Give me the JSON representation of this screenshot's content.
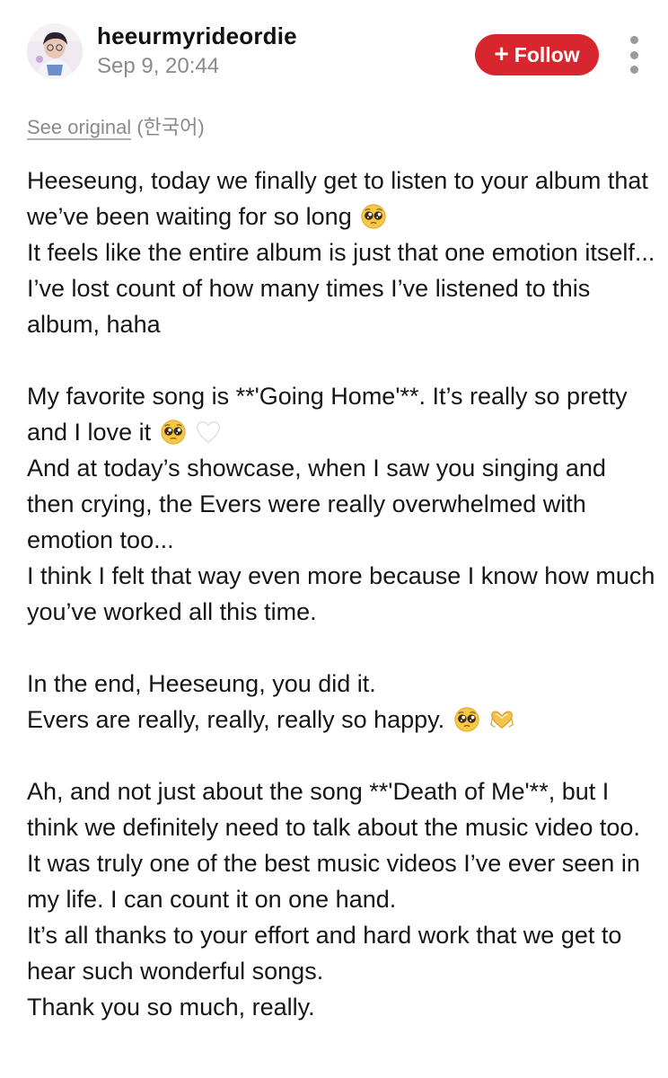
{
  "post": {
    "author": {
      "username": "heeurmyrideordie",
      "avatar": "profile-avatar"
    },
    "timestamp": "Sep 9, 20:44",
    "follow_label": "Follow",
    "follow_icon": "+",
    "more_icon": "more-vertical-icon",
    "accent_color": "#d8262e",
    "see_original": {
      "link_label": "See original",
      "language": "(한국어)"
    },
    "paragraphs": [
      {
        "lines": [
          {
            "text": "Heeseung, today we finally get to listen to your album that we’ve been waiting for so long",
            "emojis": [
              "pleading-face"
            ]
          },
          {
            "text": "It feels like the entire album is just that one emotion itself... I’ve lost count of how many times I’ve listened to this album, haha",
            "emojis": []
          }
        ]
      },
      {
        "lines": [
          {
            "text": "My favorite song is **'Going Home'**. It’s really so pretty and I love it",
            "emojis": [
              "pleading-face",
              "white-heart"
            ]
          },
          {
            "text": "And at today’s showcase, when I saw you singing and then crying, the Evers were really overwhelmed with emotion too...",
            "emojis": []
          },
          {
            "text": "I think I felt that way even more because I know how much you’ve worked all this time.",
            "emojis": []
          }
        ]
      },
      {
        "lines": [
          {
            "text": "In the end, Heeseung, you did it.",
            "emojis": []
          },
          {
            "text": "Evers are really, really, really so happy.",
            "emojis": [
              "pleading-face",
              "heart-hands"
            ]
          }
        ]
      },
      {
        "lines": [
          {
            "text": "Ah, and not just about the song **'Death of Me'**, but I think we definitely need to talk about the music video too.",
            "emojis": []
          },
          {
            "text": "It was truly one of the best music videos I’ve ever seen in my life. I can count it on one hand.",
            "emojis": []
          },
          {
            "text": "It’s all thanks to your effort and hard work that we get to hear such wonderful songs.",
            "emojis": []
          },
          {
            "text": "Thank you so much, really.",
            "emojis": []
          }
        ]
      }
    ]
  }
}
